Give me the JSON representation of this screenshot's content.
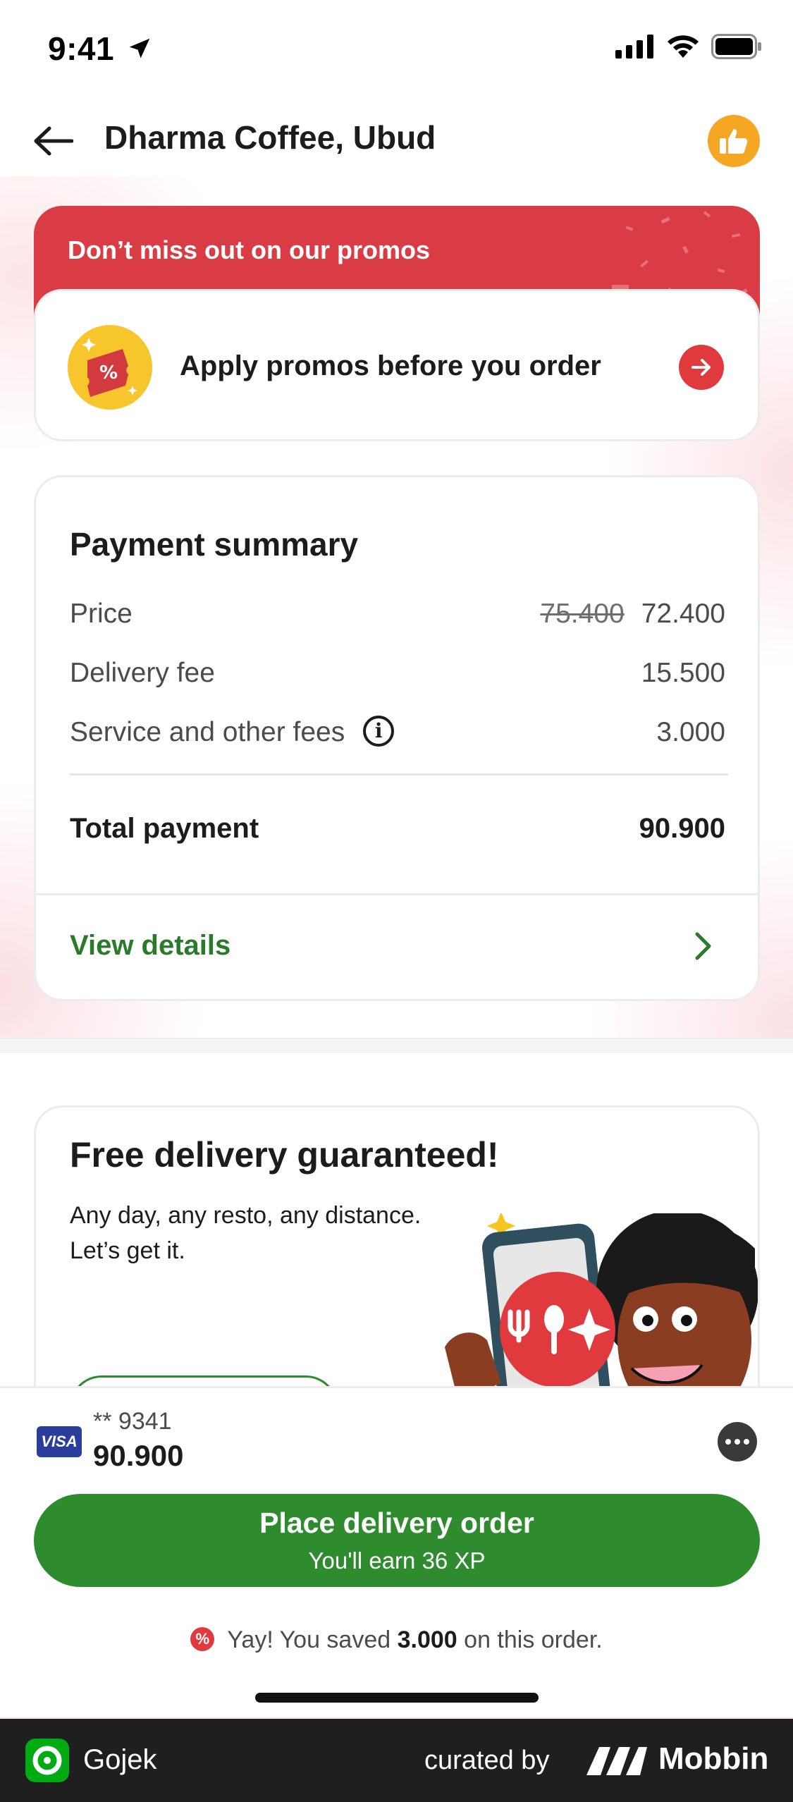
{
  "status_bar": {
    "time": "9:41"
  },
  "header": {
    "title": "Dharma Coffee, Ubud"
  },
  "promo": {
    "banner_text": "Don’t miss out on our promos",
    "apply_label": "Apply promos before you order"
  },
  "payment_summary": {
    "title": "Payment summary",
    "rows": [
      {
        "label": "Price",
        "original": "75.400",
        "value": "72.400"
      },
      {
        "label": "Delivery fee",
        "value": "15.500"
      },
      {
        "label": "Service and other fees",
        "value": "3.000"
      }
    ],
    "total_label": "Total payment",
    "total_value": "90.900",
    "view_details": "View details"
  },
  "free_delivery": {
    "title": "Free delivery guaranteed!",
    "desc_line1": "Any day, any resto, any distance.",
    "desc_line2": "Let’s get it."
  },
  "checkout": {
    "card_brand": "VISA",
    "card_masked": "** 9341",
    "amount": "90.900",
    "place_label": "Place delivery order",
    "place_sub": "You'll earn 36 XP",
    "saved_prefix": "Yay! You saved",
    "saved_amount": "3.000",
    "saved_suffix": "on this order."
  },
  "footer": {
    "app_name": "Gojek",
    "curated_by": "curated by",
    "brand": "Mobbin"
  },
  "colors": {
    "brand_green": "#2e8b2e",
    "promo_red": "#da3c45",
    "thumb_orange": "#f5a623"
  }
}
